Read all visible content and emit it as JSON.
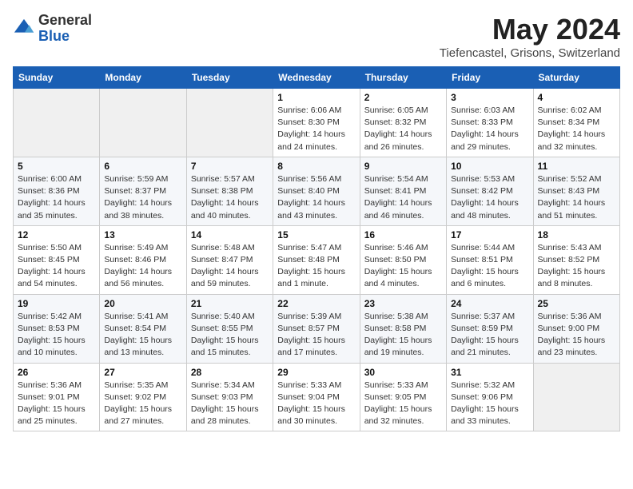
{
  "header": {
    "logo_line1": "General",
    "logo_line2": "Blue",
    "month": "May 2024",
    "location": "Tiefencastel, Grisons, Switzerland"
  },
  "weekdays": [
    "Sunday",
    "Monday",
    "Tuesday",
    "Wednesday",
    "Thursday",
    "Friday",
    "Saturday"
  ],
  "weeks": [
    [
      {
        "day": "",
        "info": ""
      },
      {
        "day": "",
        "info": ""
      },
      {
        "day": "",
        "info": ""
      },
      {
        "day": "1",
        "info": "Sunrise: 6:06 AM\nSunset: 8:30 PM\nDaylight: 14 hours\nand 24 minutes."
      },
      {
        "day": "2",
        "info": "Sunrise: 6:05 AM\nSunset: 8:32 PM\nDaylight: 14 hours\nand 26 minutes."
      },
      {
        "day": "3",
        "info": "Sunrise: 6:03 AM\nSunset: 8:33 PM\nDaylight: 14 hours\nand 29 minutes."
      },
      {
        "day": "4",
        "info": "Sunrise: 6:02 AM\nSunset: 8:34 PM\nDaylight: 14 hours\nand 32 minutes."
      }
    ],
    [
      {
        "day": "5",
        "info": "Sunrise: 6:00 AM\nSunset: 8:36 PM\nDaylight: 14 hours\nand 35 minutes."
      },
      {
        "day": "6",
        "info": "Sunrise: 5:59 AM\nSunset: 8:37 PM\nDaylight: 14 hours\nand 38 minutes."
      },
      {
        "day": "7",
        "info": "Sunrise: 5:57 AM\nSunset: 8:38 PM\nDaylight: 14 hours\nand 40 minutes."
      },
      {
        "day": "8",
        "info": "Sunrise: 5:56 AM\nSunset: 8:40 PM\nDaylight: 14 hours\nand 43 minutes."
      },
      {
        "day": "9",
        "info": "Sunrise: 5:54 AM\nSunset: 8:41 PM\nDaylight: 14 hours\nand 46 minutes."
      },
      {
        "day": "10",
        "info": "Sunrise: 5:53 AM\nSunset: 8:42 PM\nDaylight: 14 hours\nand 48 minutes."
      },
      {
        "day": "11",
        "info": "Sunrise: 5:52 AM\nSunset: 8:43 PM\nDaylight: 14 hours\nand 51 minutes."
      }
    ],
    [
      {
        "day": "12",
        "info": "Sunrise: 5:50 AM\nSunset: 8:45 PM\nDaylight: 14 hours\nand 54 minutes."
      },
      {
        "day": "13",
        "info": "Sunrise: 5:49 AM\nSunset: 8:46 PM\nDaylight: 14 hours\nand 56 minutes."
      },
      {
        "day": "14",
        "info": "Sunrise: 5:48 AM\nSunset: 8:47 PM\nDaylight: 14 hours\nand 59 minutes."
      },
      {
        "day": "15",
        "info": "Sunrise: 5:47 AM\nSunset: 8:48 PM\nDaylight: 15 hours\nand 1 minute."
      },
      {
        "day": "16",
        "info": "Sunrise: 5:46 AM\nSunset: 8:50 PM\nDaylight: 15 hours\nand 4 minutes."
      },
      {
        "day": "17",
        "info": "Sunrise: 5:44 AM\nSunset: 8:51 PM\nDaylight: 15 hours\nand 6 minutes."
      },
      {
        "day": "18",
        "info": "Sunrise: 5:43 AM\nSunset: 8:52 PM\nDaylight: 15 hours\nand 8 minutes."
      }
    ],
    [
      {
        "day": "19",
        "info": "Sunrise: 5:42 AM\nSunset: 8:53 PM\nDaylight: 15 hours\nand 10 minutes."
      },
      {
        "day": "20",
        "info": "Sunrise: 5:41 AM\nSunset: 8:54 PM\nDaylight: 15 hours\nand 13 minutes."
      },
      {
        "day": "21",
        "info": "Sunrise: 5:40 AM\nSunset: 8:55 PM\nDaylight: 15 hours\nand 15 minutes."
      },
      {
        "day": "22",
        "info": "Sunrise: 5:39 AM\nSunset: 8:57 PM\nDaylight: 15 hours\nand 17 minutes."
      },
      {
        "day": "23",
        "info": "Sunrise: 5:38 AM\nSunset: 8:58 PM\nDaylight: 15 hours\nand 19 minutes."
      },
      {
        "day": "24",
        "info": "Sunrise: 5:37 AM\nSunset: 8:59 PM\nDaylight: 15 hours\nand 21 minutes."
      },
      {
        "day": "25",
        "info": "Sunrise: 5:36 AM\nSunset: 9:00 PM\nDaylight: 15 hours\nand 23 minutes."
      }
    ],
    [
      {
        "day": "26",
        "info": "Sunrise: 5:36 AM\nSunset: 9:01 PM\nDaylight: 15 hours\nand 25 minutes."
      },
      {
        "day": "27",
        "info": "Sunrise: 5:35 AM\nSunset: 9:02 PM\nDaylight: 15 hours\nand 27 minutes."
      },
      {
        "day": "28",
        "info": "Sunrise: 5:34 AM\nSunset: 9:03 PM\nDaylight: 15 hours\nand 28 minutes."
      },
      {
        "day": "29",
        "info": "Sunrise: 5:33 AM\nSunset: 9:04 PM\nDaylight: 15 hours\nand 30 minutes."
      },
      {
        "day": "30",
        "info": "Sunrise: 5:33 AM\nSunset: 9:05 PM\nDaylight: 15 hours\nand 32 minutes."
      },
      {
        "day": "31",
        "info": "Sunrise: 5:32 AM\nSunset: 9:06 PM\nDaylight: 15 hours\nand 33 minutes."
      },
      {
        "day": "",
        "info": ""
      }
    ]
  ]
}
